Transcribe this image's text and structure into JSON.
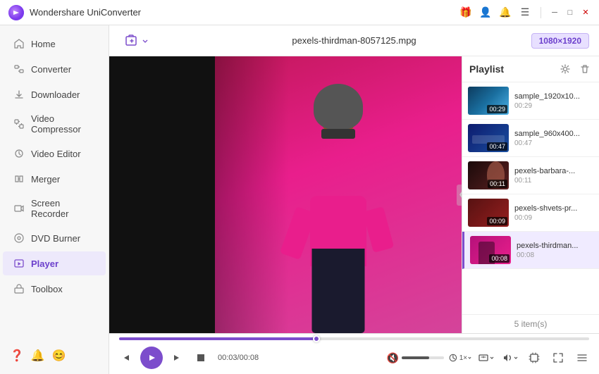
{
  "app": {
    "title": "Wondershare UniConverter",
    "logo_alt": "UniConverter Logo"
  },
  "titlebar": {
    "icons": [
      "gift-icon",
      "user-icon",
      "bell-icon",
      "menu-icon"
    ],
    "window_controls": [
      "minimize",
      "maximize",
      "close"
    ]
  },
  "sidebar": {
    "items": [
      {
        "id": "home",
        "label": "Home",
        "icon": "home-icon",
        "active": false
      },
      {
        "id": "converter",
        "label": "Converter",
        "icon": "converter-icon",
        "active": false
      },
      {
        "id": "downloader",
        "label": "Downloader",
        "icon": "downloader-icon",
        "active": false
      },
      {
        "id": "video-compressor",
        "label": "Video Compressor",
        "icon": "compressor-icon",
        "active": false
      },
      {
        "id": "video-editor",
        "label": "Video Editor",
        "icon": "editor-icon",
        "active": false
      },
      {
        "id": "merger",
        "label": "Merger",
        "icon": "merger-icon",
        "active": false
      },
      {
        "id": "screen-recorder",
        "label": "Screen Recorder",
        "icon": "recorder-icon",
        "active": false
      },
      {
        "id": "dvd-burner",
        "label": "DVD Burner",
        "icon": "dvd-icon",
        "active": false
      },
      {
        "id": "player",
        "label": "Player",
        "icon": "player-icon",
        "active": true
      },
      {
        "id": "toolbox",
        "label": "Toolbox",
        "icon": "toolbox-icon",
        "active": false
      }
    ]
  },
  "topbar": {
    "add_label": "",
    "file_name": "pexels-thirdman-8057125.mpg",
    "resolution": "1080×1920"
  },
  "player": {
    "current_time": "00:03",
    "total_time": "00:08",
    "time_display": "00:03/00:08",
    "progress_percent": 42,
    "volume_percent": 65
  },
  "playlist": {
    "title": "Playlist",
    "item_count": "5 item(s)",
    "items": [
      {
        "id": 1,
        "name": "sample_1920x10...",
        "duration": "00:29",
        "thumb_class": "thumb-bg-ocean",
        "active": false
      },
      {
        "id": 2,
        "name": "sample_960x400...",
        "duration": "00:47",
        "thumb_class": "thumb-bg-blue",
        "active": false
      },
      {
        "id": 3,
        "name": "pexels-barbara-...",
        "duration": "00:11",
        "thumb_class": "thumb-bg-dark",
        "active": false
      },
      {
        "id": 4,
        "name": "pexels-shvets-pr...",
        "duration": "00:09",
        "thumb_class": "thumb-bg-red",
        "active": false
      },
      {
        "id": 5,
        "name": "pexels-thirdman...",
        "duration": "00:08",
        "thumb_class": "thumb-bg-pink",
        "active": true
      }
    ]
  },
  "controls": {
    "prev_label": "⏮",
    "play_label": "▶",
    "next_label": "⏭",
    "stop_label": "⏹",
    "speed_label": "1×",
    "aspect_label": "⛶",
    "fullscreen_label": "⛶",
    "settings_label": "≡"
  },
  "colors": {
    "accent": "#7c4dcc",
    "sidebar_active_bg": "#ede9fb",
    "sidebar_active_text": "#6c40cc"
  }
}
